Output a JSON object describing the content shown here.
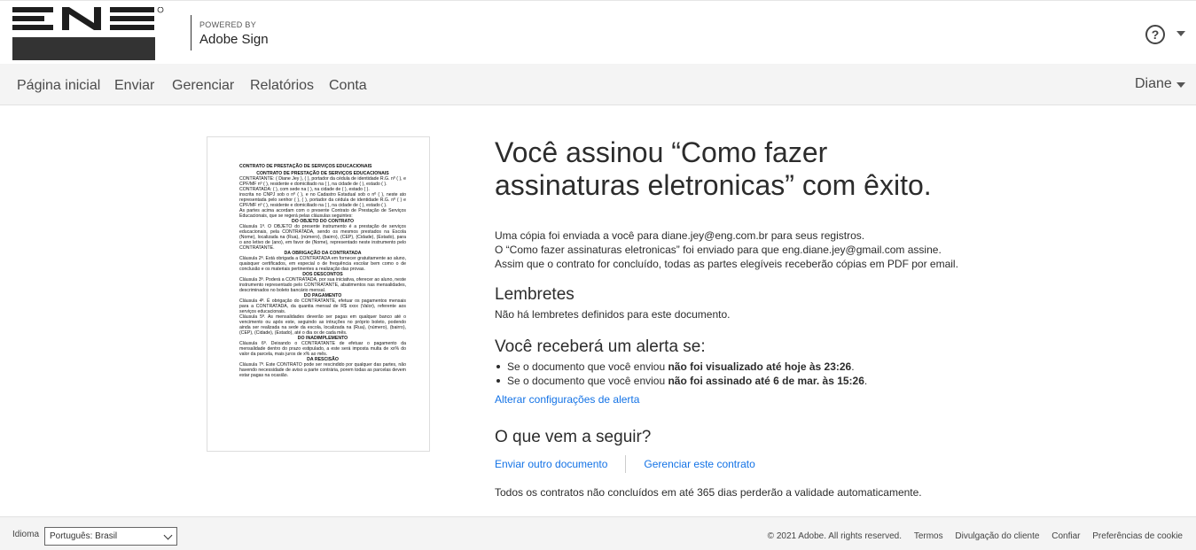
{
  "header": {
    "powered_by": "POWERED BY",
    "product": "Adobe Sign",
    "help_symbol": "?",
    "icons": [
      "eng-logo",
      "help-icon",
      "chevron-down-icon"
    ]
  },
  "nav": {
    "items": [
      "Página inicial",
      "Enviar",
      "Gerenciar",
      "Relatórios",
      "Conta"
    ],
    "user": "Diane"
  },
  "document_preview": {
    "lines": [
      {
        "t": "CONTRATO DE PRESTAÇÃO DE SERVIÇOS EDUCACIONAIS",
        "k": "title"
      },
      {
        "t": "CONTRATO DE PRESTAÇÃO DE SERVIÇOS EDUCACIONAIS",
        "k": "head"
      },
      {
        "t": "CONTRATANTE: ( Diane Jey ), ( ), portador da cédula de identidade R.G. nº ( ), e CPF/MF nº ( ), residente e domiciliado na ( ), na cidade de ( ), estado ( )."
      },
      {
        "t": "CONTRATADA: ( ), com sede na ( ), na cidade de ( ), estado ( )."
      },
      {
        "t": "inscrita no CNPJ sob o nº ( ), e no Cadastro Estadual sob o nº ( ), neste ato representada pelo senhor ( ), ( ), portador da cédula de identidade R.G. nº ( ) e CPF/MF nº ( ), residente e domiciliado na ( ), na cidade de ( ), estado ( )."
      },
      {
        "t": "As partes acima acordam com o presente Contrato de Prestação de Serviços Educacionais, que se regerá pelas cláusulas seguintes:"
      },
      {
        "t": "DO OBJETO DO CONTRATO",
        "k": "head"
      },
      {
        "t": "Cláusula 1ª. O OBJETO do presente instrumento é a prestação de serviços educacionais, pela CONTRATADA, sendo os mesmos prestados na Escola (Nome), localizada na (Rua), (número), (bairro), (CEP), (Cidade), (Estado), para o ano letivo de (ano), em favor de (Nome), representado neste instrumento pelo CONTRATANTE."
      },
      {
        "t": "DA OBRIGAÇÃO DA CONTRATADA",
        "k": "head"
      },
      {
        "t": "Cláusula 2ª. Está obrigada a CONTRATADA em fornecer gratuitamente ao aluno, quaisquer certificados, em especial o de frequência escolar bem como o de conclusão e os materiais pertinentes a realização das provas."
      },
      {
        "t": "DOS DESCONTOS",
        "k": "head"
      },
      {
        "t": "Cláusula 3ª. Poderá a CONTRATADA, por sua iniciativa, oferecer ao aluno, neste instrumento representado pelo CONTRATANTE, abatimentos nas mensalidades, descriminados no boleto bancário mensal."
      },
      {
        "t": "DO PAGAMENTO",
        "k": "head"
      },
      {
        "t": "Cláusula 4ª. É obrigação do CONTRATANTE, efetuar os pagamentos mensais para a CONTRATADA, da quantia mensal de R$ xxxx (Valor), referente aos serviços educacionais."
      },
      {
        "t": "Cláusula 5ª. As mensalidades deverão ser pagas em qualquer banco até o vencimento ou após este, seguindo as intruções no próprio boleto, podendo ainda ser realizada na sede da escola, localizada na (Rua), (número), (bairro), (CEP), (Cidade), (Estado), até o dia xx de cada mês."
      },
      {
        "t": "DO INADIMPLEMENTO",
        "k": "head"
      },
      {
        "t": "Cláusula 6ª. Deixando o CONTRATANTE de efetuar o pagamento da mensalidade dentro do prazo estipulado, a este será imposta multa de xx% do valor da parcela, mais juros de x% ao mês."
      },
      {
        "t": "DA RESCISÃO",
        "k": "head"
      },
      {
        "t": "Cláusula 7ª. Este CONTRATO pode ser rescindido por qualquer das partes, não havendo necessidade de aviso a parte contrária, porem todas as parcelas devem estar pagas na ocasião."
      }
    ]
  },
  "main": {
    "title": "Você assinou “Como fazer assinaturas eletronicas” com êxito.",
    "info_1": "Uma cópia foi enviada a você para diane.jey@eng.com.br para seus registros.",
    "info_2": "O “Como fazer assinaturas eletronicas” foi enviado para que eng.diane.jey@gmail.com assine.",
    "info_3": "Assim que o contrato for concluído, todas as partes elegíveis receberão cópias em PDF por email.",
    "reminders_heading": "Lembretes",
    "reminders_text": "Não há lembretes definidos para este documento.",
    "alert_heading": "Você receberá um alerta se:",
    "alert_1_prefix": "Se o documento que você enviou ",
    "alert_1_bold": "não foi visualizado até hoje às 23:26",
    "alert_1_suffix": ".",
    "alert_2_prefix": "Se o documento que você enviou ",
    "alert_2_bold": "não foi assinado até 6 de mar. às 15:26",
    "alert_2_suffix": ".",
    "alert_link": "Alterar configurações de alerta",
    "next_heading": "O que vem a seguir?",
    "next_link_1": "Enviar outro documento",
    "next_link_2": "Gerenciar este contrato",
    "expiry_note": "Todos os contratos não concluídos em até 365 dias perderão a validade automaticamente."
  },
  "footer": {
    "lang_label": "Idioma",
    "lang_value": "Português: Brasil",
    "copyright": "© 2021 Adobe. All rights reserved.",
    "links": [
      "Termos",
      "Divulgação do cliente",
      "Confiar",
      "Preferências de cookie"
    ]
  },
  "colors": {
    "link": "#1473e6",
    "nav_bg": "#f4f4f4",
    "text": "#2c2c2c"
  }
}
